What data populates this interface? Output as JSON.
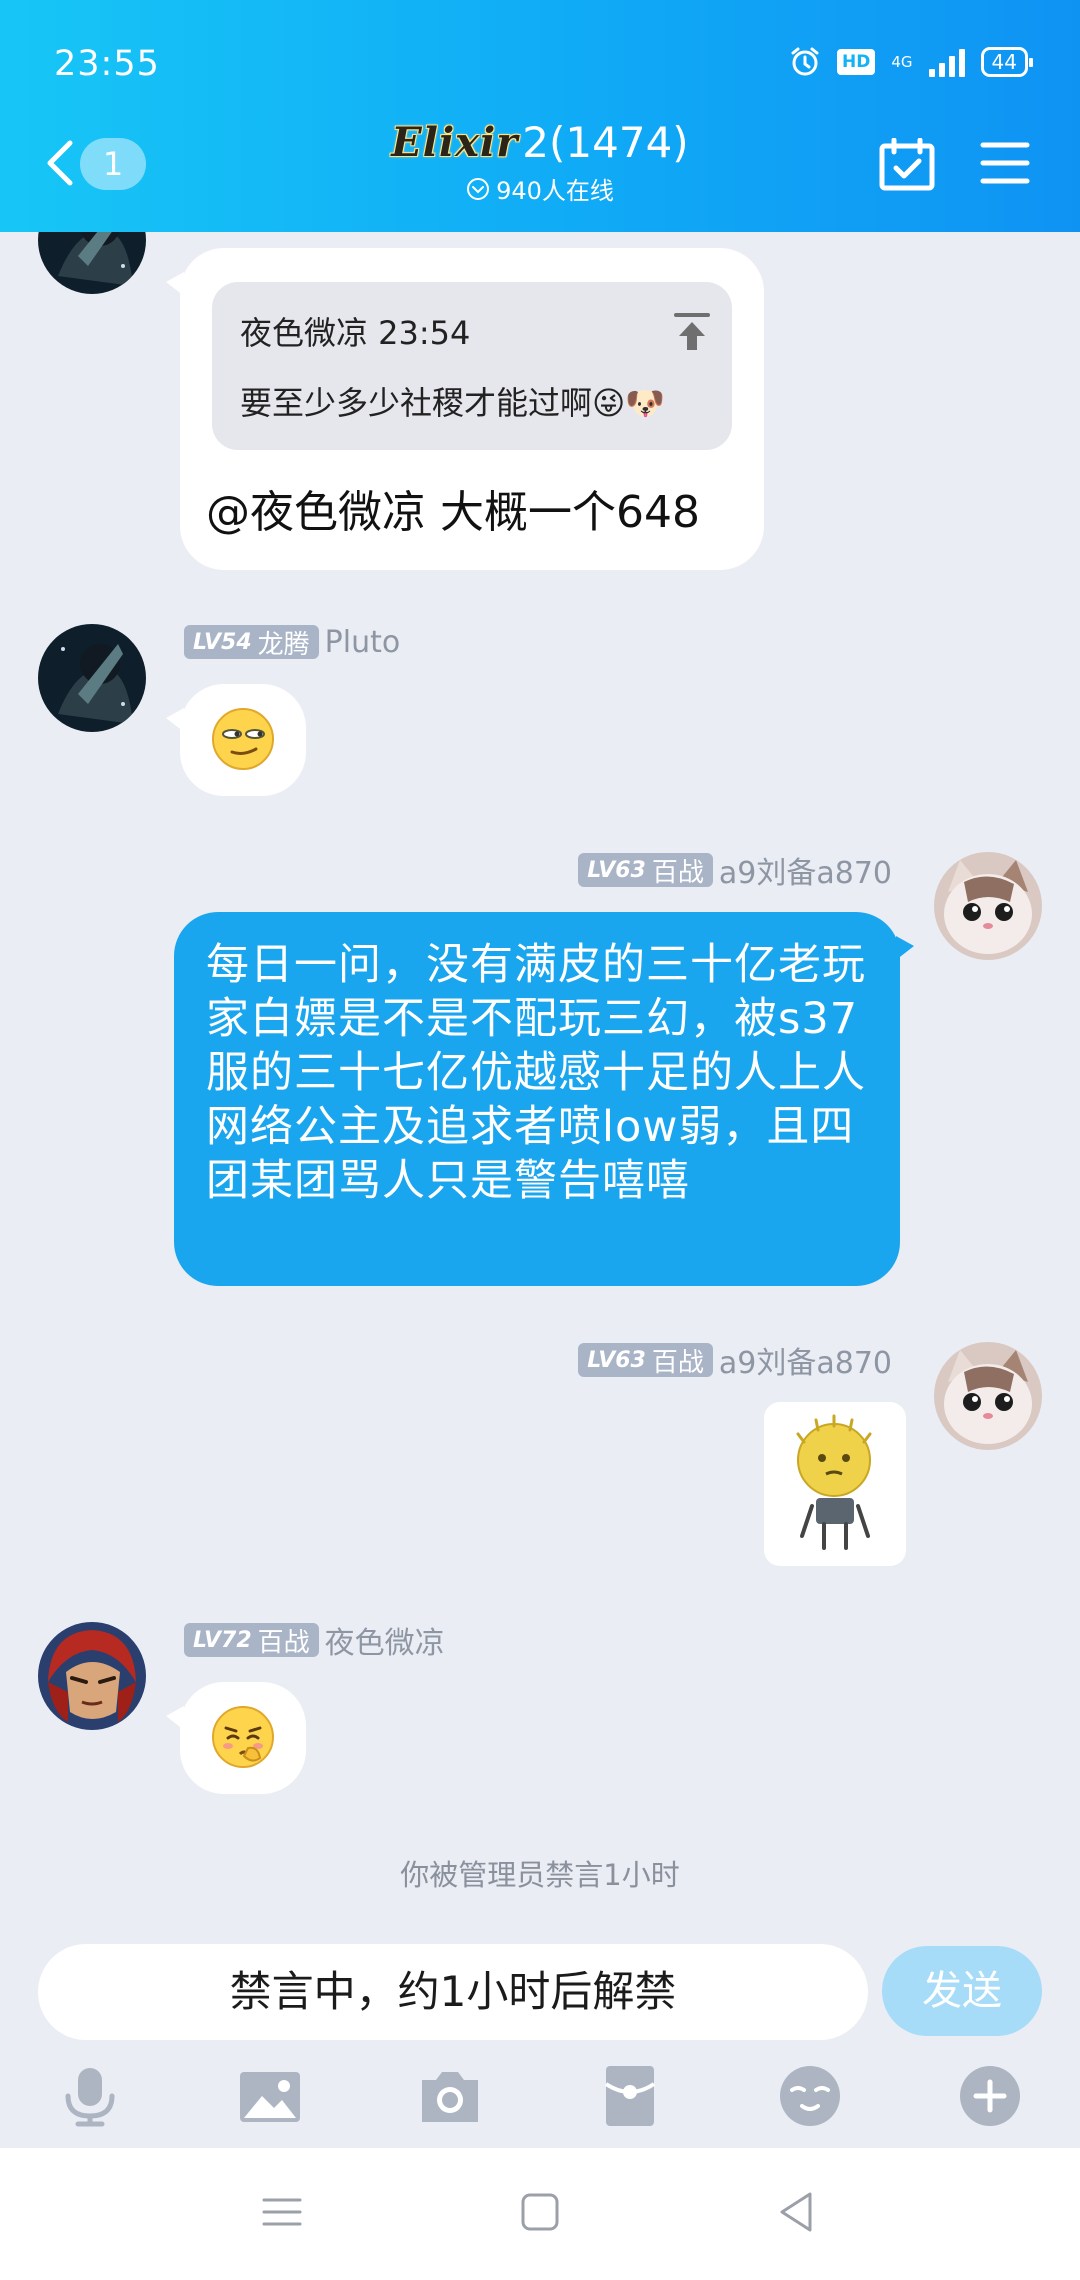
{
  "status_bar": {
    "time": "23:55",
    "hd": "HD",
    "network": "4G",
    "battery": "44"
  },
  "header": {
    "back_badge": "1",
    "logo_text": "Elixir",
    "title": "2(1474)",
    "online": "940人在线",
    "icons": [
      "back-arrow-icon",
      "calendar-check-icon",
      "menu-icon"
    ]
  },
  "messages": [
    {
      "side": "left",
      "avatar": "dark-anime-avatar",
      "quote_header": "夜色微凉 23:54",
      "quote_text": "要至少多少社稷才能过啊😜🐶",
      "text": "@夜色微凉 大概一个648"
    },
    {
      "side": "left",
      "avatar": "dark-anime-avatar",
      "level": "LV54",
      "title": "龙腾",
      "nickname": "Pluto",
      "sticker": "smirk-emoji"
    },
    {
      "side": "right",
      "avatar": "cat-avatar",
      "level": "LV63",
      "title": "百战",
      "nickname": "a9刘备a870",
      "text": "每日一问，没有满皮的三十亿老玩家白嫖是不是不配玩三幻，被s37服的三十七亿优越感十足的人上人网络公主及追求者喷low弱，且四团某团骂人只是警告嘻嘻"
    },
    {
      "side": "right",
      "avatar": "cat-avatar",
      "level": "LV63",
      "title": "百战",
      "nickname": "a9刘备a870",
      "sticker": "yellow-blob-sticker"
    },
    {
      "side": "left",
      "avatar": "red-hair-avatar",
      "level": "LV72",
      "title": "百战",
      "nickname": "夜色微凉",
      "sticker": "shy-emoji"
    }
  ],
  "system_note": "你被管理员禁言1小时",
  "input": {
    "placeholder": "禁言中，约1小时后解禁",
    "send_label": "发送"
  },
  "toolbar": [
    "microphone-icon",
    "image-icon",
    "camera-icon",
    "red-packet-icon",
    "emoji-icon",
    "plus-icon"
  ],
  "colors": {
    "header": "#10aaf6",
    "my_bubble": "#1aa5ef",
    "background": "#eaedf4",
    "level_badge": "#a9b4c7",
    "send_disabled": "#a7dcf8"
  }
}
